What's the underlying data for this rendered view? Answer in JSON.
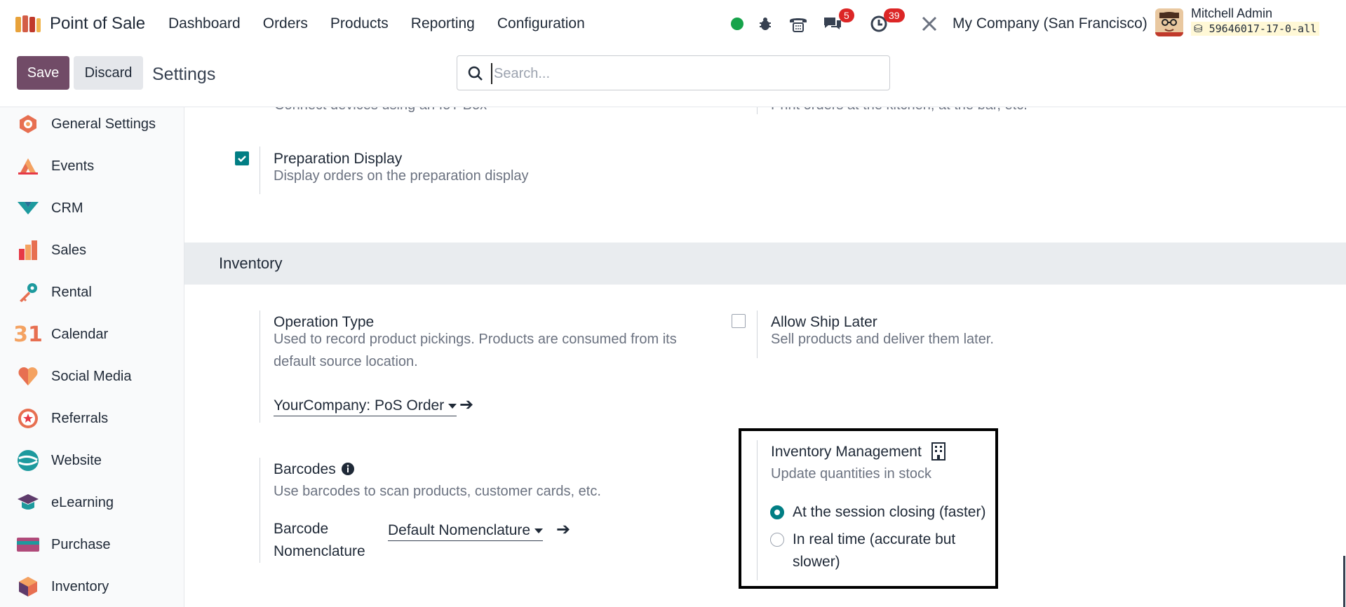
{
  "navbar": {
    "app_name": "Point of Sale",
    "menu": [
      "Dashboard",
      "Orders",
      "Products",
      "Reporting",
      "Configuration"
    ],
    "messages_count": "5",
    "activities_count": "39",
    "company": "My Company (San Francisco)",
    "user_name": "Mitchell Admin",
    "db_name": "59646017-17-0-all"
  },
  "control": {
    "save_label": "Save",
    "discard_label": "Discard",
    "title": "Settings",
    "search_placeholder": "Search..."
  },
  "sidebar": {
    "items": [
      {
        "label": "General Settings",
        "icon": "general-settings-icon"
      },
      {
        "label": "Events",
        "icon": "events-icon"
      },
      {
        "label": "CRM",
        "icon": "crm-icon"
      },
      {
        "label": "Sales",
        "icon": "sales-icon"
      },
      {
        "label": "Rental",
        "icon": "rental-icon"
      },
      {
        "label": "Calendar",
        "icon": "calendar-icon"
      },
      {
        "label": "Social Media",
        "icon": "social-media-icon"
      },
      {
        "label": "Referrals",
        "icon": "referrals-icon"
      },
      {
        "label": "Website",
        "icon": "website-icon"
      },
      {
        "label": "eLearning",
        "icon": "elearning-icon"
      },
      {
        "label": "Purchase",
        "icon": "purchase-icon"
      },
      {
        "label": "Inventory",
        "icon": "inventory-icon"
      }
    ]
  },
  "main": {
    "cutoff_left": "Connect devices using an IoT Box",
    "cutoff_right": "Print orders at the kitchen, at the bar, etc.",
    "prep_display": {
      "title": "Preparation Display",
      "desc": "Display orders on the preparation display",
      "checked": true
    },
    "inventory_section": "Inventory",
    "operation_type": {
      "title": "Operation Type",
      "desc_line1": "Used to record product pickings. Products are consumed from its",
      "desc_line2": "default source location.",
      "value": "YourCompany: PoS Order"
    },
    "ship_later": {
      "title": "Allow Ship Later",
      "desc": "Sell products and deliver them later.",
      "checked": false
    },
    "barcodes": {
      "title": "Barcodes",
      "desc": "Use barcodes to scan products, customer cards, etc.",
      "nomenclature_label_1": "Barcode",
      "nomenclature_label_2": "Nomenclature",
      "nomenclature_value": "Default Nomenclature"
    },
    "inventory_management": {
      "title": "Inventory Management",
      "desc": "Update quantities in stock",
      "option_1": "At the session closing (faster)",
      "option_2_line1": "In real time (accurate but",
      "option_2_line2": "slower)",
      "selected": "option_1"
    }
  },
  "colors": {
    "brand": "#714b67",
    "accent": "#017e84",
    "badge": "#dc2626"
  }
}
